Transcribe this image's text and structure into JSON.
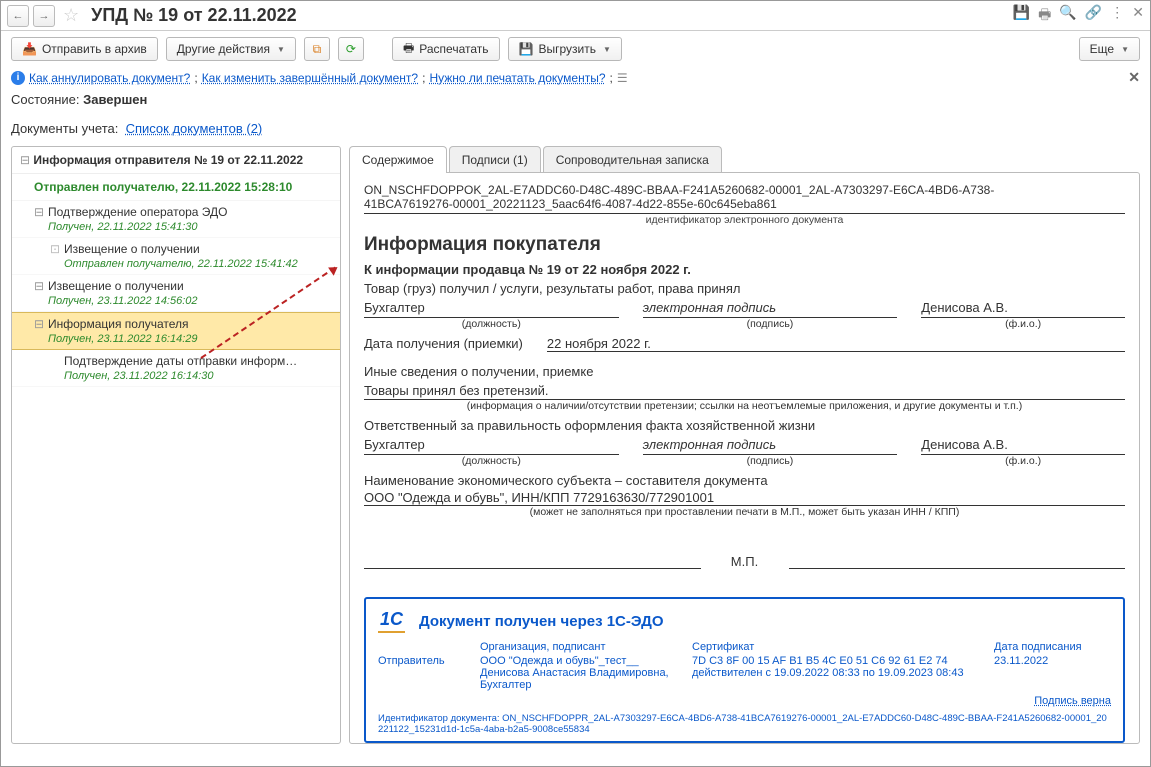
{
  "title": "УПД № 19 от 22.11.2022",
  "toolbar": {
    "archive": "Отправить в архив",
    "other": "Другие действия",
    "print": "Распечатать",
    "export": "Выгрузить",
    "more": "Еще"
  },
  "help": {
    "q1": "Как аннулировать документ?",
    "q2": "Как изменить завершённый документ?",
    "q3": "Нужно ли печатать документы?"
  },
  "state": {
    "label": "Состояние:",
    "value": "Завершен"
  },
  "docs_row": {
    "label": "Документы учета:",
    "link": "Список документов (2)"
  },
  "tree": {
    "root": "Информация отправителя № 19 от 22.11.2022",
    "sent": "Отправлен получателю, 22.11.2022 15:28:10",
    "items": [
      {
        "t": "Подтверждение оператора ЭДО",
        "s": "Получен, 22.11.2022 15:41:30"
      },
      {
        "t": "Извещение о получении",
        "s": "Отправлен получателю, 22.11.2022 15:41:42",
        "lvl": 2
      },
      {
        "t": "Извещение о получении",
        "s": "Получен, 23.11.2022 14:56:02"
      },
      {
        "t": "Информация получателя",
        "s": "Получен, 23.11.2022 16:14:29",
        "hl": true
      },
      {
        "t": "Подтверждение даты отправки информ…",
        "s": "Получен, 23.11.2022 16:14:30",
        "lvl": 2
      }
    ]
  },
  "tabs": {
    "content": "Содержимое",
    "sign": "Подписи (1)",
    "note": "Сопроводительная записка"
  },
  "doc": {
    "id_line1": "ON_NSCHFDOPPOK_2AL-E7ADDC60-D48C-489C-BBAA-F241A5260682-00001_2AL-A7303297-E6CA-4BD6-A738-",
    "id_line2": "41BCA7619276-00001_20221123_5aac64f6-4087-4d22-855e-60c645eba861",
    "id_caption": "идентификатор электронного документа",
    "h2": "Информация покупателя",
    "seller_ref": "К информации продавца № 19 от 22 ноября 2022 г.",
    "receive_title": "Товар (груз) получил / услуги, результаты работ, права принял",
    "row1": {
      "pos": "Бухгалтер",
      "sign": "электронная подпись",
      "fio": "Денисова А.В."
    },
    "captions": {
      "pos": "(должность)",
      "sign": "(подпись)",
      "fio": "(ф.и.о.)"
    },
    "date_label": "Дата получения (приемки)",
    "date_value": "22 ноября 2022 г.",
    "other_info": "Иные сведения о получении, приемке",
    "other_val": "Товары принял без претензий.",
    "other_caption": "(информация о наличии/отсутствии претензии; ссылки на неотъемлемые приложения, и другие  документы и т.п.)",
    "resp_title": "Ответственный за правильность оформления факта хозяйственной жизни",
    "row2": {
      "pos": "Бухгалтер",
      "sign": "электронная подпись",
      "fio": "Денисова А.В."
    },
    "econ_title": "Наименование экономического субъекта – составителя документа",
    "econ_val": "ООО \"Одежда и обувь\", ИНН/КПП 7729163630/772901001",
    "econ_caption": "(может не заполняться при проставлении печати в М.П., может быть указан ИНН / КПП)",
    "mp": "М.П."
  },
  "edo": {
    "title": "Документ получен через 1С-ЭДО",
    "sender_label": "Отправитель",
    "org_label": "Организация, подписант",
    "org_val": "ООО \"Одежда и обувь\"_тест__\nДенисова Анастасия Владимировна, Бухгалтер",
    "cert_label": "Сертификат",
    "cert_val": "7D C3 8F 00 15 AF B1 B5 4C E0 51 C6 92 61 E2 74\nдействителен с 19.09.2022 08:33 по 19.09.2023 08:43",
    "date_label": "Дата подписания",
    "date_val": "23.11.2022",
    "sig_ok": "Подпись верна",
    "doc_id": "Идентификатор документа: ON_NSCHFDOPPR_2AL-A7303297-E6CA-4BD6-A738-41BCA7619276-00001_2AL-E7ADDC60-D48C-489C-BBAA-F241A5260682-00001_20221122_15231d1d-1c5a-4aba-b2a5-9008ce55834"
  }
}
